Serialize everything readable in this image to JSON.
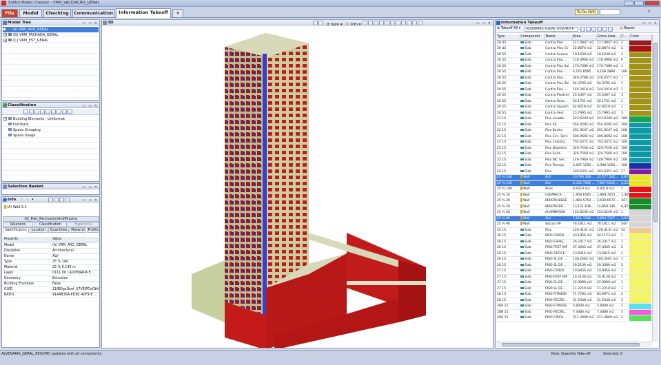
{
  "window": {
    "title": "Solibri Model Checker - VRM_VALIDAÇÃO_GERAL"
  },
  "tabs": [
    {
      "label": "File"
    },
    {
      "label": "Model"
    },
    {
      "label": "Checking"
    },
    {
      "label": "Communication"
    },
    {
      "label": "Information Takeoff"
    },
    {
      "label": "+"
    }
  ],
  "todo": {
    "label": "To-Do (3/6)"
  },
  "model_tree": {
    "title": "Model Tree",
    "items": [
      {
        "label": "(A) VRM_ARQ_GERAL"
      },
      {
        "label": "(B) VRM_FACHADA_GERAL"
      },
      {
        "label": "(C) VRM_EST_GERAL"
      }
    ]
  },
  "classification": {
    "title": "Classification",
    "items": [
      {
        "label": "Building Elements - Uniformat"
      },
      {
        "label": "Furniture"
      },
      {
        "label": "Space Grouping"
      },
      {
        "label": "Space Usage"
      }
    ]
  },
  "selection_basket": {
    "title": "Selection Basket"
  },
  "info": {
    "title": "Info",
    "element": "(A) Wall.5.1",
    "top_tabs": [
      "AC_Pset_RenovationAndPhasing"
    ],
    "tabs_row1": [
      "Relations",
      "Classification",
      "Hyperlinks"
    ],
    "tabs_row2": [
      "Identification",
      "Location",
      "Quantities",
      "Material",
      "Profile"
    ],
    "header": {
      "property": "Property",
      "value": "Value"
    },
    "rows": [
      {
        "p": "Model",
        "v": "(A) VRM_ARQ_GERAL"
      },
      {
        "p": "Discipline",
        "v": "Architectural"
      },
      {
        "p": "Name",
        "v": "ALV"
      },
      {
        "p": "Type",
        "v": "25 % 140"
      },
      {
        "p": "Material",
        "v": "25 % 0.140 m"
      },
      {
        "p": "Layer",
        "v": "0111 00 | ALVENARIA E..."
      },
      {
        "p": "Geometry",
        "v": "Extrusion"
      },
      {
        "p": "Building Envelope",
        "v": "False"
      },
      {
        "p": "GUID",
        "v": "11fBOgxOzof_U7VEIPDxObV"
      },
      {
        "p": "BATID",
        "v": "41A4B36A-EDBC-40F9-E..."
      }
    ]
  },
  "view3d": {
    "title": "3D",
    "spin": "Spin",
    "info": "Info"
  },
  "takeoff": {
    "title": "Information Takeoff",
    "takeoff_label": "Takeoff All",
    "selected_takeoff": "ALVENARIA_GERAL_RESUMO",
    "report": "Report",
    "columns": [
      "Type",
      "Component",
      "Name",
      "Area",
      "Gross Area",
      "C...",
      "Color"
    ],
    "rows": [
      {
        "type": "20 45",
        "comp": "Slab",
        "name": "Contra Piso",
        "area": "117.0847 m2",
        "gross": "117.0847 m2",
        "c": "2",
        "color": "#9a1c1c"
      },
      {
        "type": "20 45",
        "comp": "Slab",
        "name": "Contra Piso Cir",
        "area": "22.8874 m2",
        "gross": "22.8874 m2",
        "c": "2",
        "color": "#a8140e"
      },
      {
        "type": "20 55",
        "comp": "Slab",
        "name": "Contra Acesso",
        "area": "10.1639 m2",
        "gross": "10.1639 m2",
        "c": "1",
        "color": "#a39314"
      },
      {
        "type": "20 55",
        "comp": "Slab",
        "name": "Contra Piso ...",
        "area": "116.4966 m2",
        "gross": "116.4966 m2",
        "c": "6",
        "color": "#a39314"
      },
      {
        "type": "20 55",
        "comp": "Slab",
        "name": "Contra Piso Sal",
        "area": "170.7486 m2",
        "gross": "170.7486 m2",
        "c": "1",
        "color": "#a39314"
      },
      {
        "type": "20 55",
        "comp": "Slab",
        "name": "Contra Piso ...",
        "area": "4,152.8585 ...",
        "gross": "4,158.2894 ...",
        "c": "106",
        "color": "#a39314"
      },
      {
        "type": "20 55",
        "comp": "Slab",
        "name": "Contra Piso ...",
        "area": "340.2788 m2",
        "gross": "376.6577 m2",
        "c": "1",
        "color": "#a39314"
      },
      {
        "type": "20 55",
        "comp": "Slab",
        "name": "Contra Piso Zel",
        "area": "54.3795 m2",
        "gross": "54.3795 m2",
        "c": "1",
        "color": "#a39314"
      },
      {
        "type": "20 55",
        "comp": "Slab",
        "name": "Contra Piso ...",
        "area": "144.2419 m2",
        "gross": "144.2419 m2",
        "c": "1",
        "color": "#a39314"
      },
      {
        "type": "20 55",
        "comp": "Slab",
        "name": "Contra PisoHall",
        "area": "25.5407 m2",
        "gross": "25.5407 m2",
        "c": "3",
        "color": "#a39314"
      },
      {
        "type": "20 55",
        "comp": "Slab",
        "name": "Contra Rece...",
        "area": "20.1751 m2",
        "gross": "20.1751 m2",
        "c": "1",
        "color": "#a39314"
      },
      {
        "type": "20 55",
        "comp": "Slab",
        "name": "Contra Squash",
        "area": "62.8219 m2",
        "gross": "62.8219 m2",
        "c": "1",
        "color": "#a39314"
      },
      {
        "type": "20 55",
        "comp": "Slab",
        "name": "Contra Vest.",
        "area": "15.7995 m2",
        "gross": "15.7995 m2",
        "c": "3",
        "color": "#a39314"
      },
      {
        "type": "21 15",
        "comp": "Slab",
        "name": "Piso Lavabo",
        "area": "223.6249 m2",
        "gross": "223.6249 m2",
        "c": "108",
        "color": "#17a44a"
      },
      {
        "type": "22 15",
        "comp": "Slab",
        "name": "Piso AS",
        "area": "554.0292 m2",
        "gross": "554.0292 m2",
        "c": "108",
        "color": "#0c9aa6"
      },
      {
        "type": "22 15",
        "comp": "Slab",
        "name": "Piso Banho",
        "area": "291.9247 m2",
        "gross": "291.9247 m2",
        "c": "108",
        "color": "#0c9aa6"
      },
      {
        "type": "22 15",
        "comp": "Slab",
        "name": "Piso Circ. Serv",
        "area": "406.0692 m2",
        "gross": "406.0692 m2",
        "c": "108",
        "color": "#0c9aa6"
      },
      {
        "type": "22 15",
        "comp": "Slab",
        "name": "Piso Cozinha",
        "area": "702.6372 m2",
        "gross": "702.6372 m2",
        "c": "108",
        "color": "#0c9aa6"
      },
      {
        "type": "22 15",
        "comp": "Slab",
        "name": "Piso Depósito",
        "area": "329.7240 m2",
        "gross": "329.7240 m2",
        "c": "108",
        "color": "#0c9aa6"
      },
      {
        "type": "22 15",
        "comp": "Slab",
        "name": "Piso Suite",
        "area": "324.7560 m2",
        "gross": "324.7560 m2",
        "c": "108",
        "color": "#0c9aa6"
      },
      {
        "type": "22 15",
        "comp": "Slab",
        "name": "Piso WC Ser...",
        "area": "149.7960 m2",
        "gross": "149.7960 m2",
        "c": "108",
        "color": "#0c9aa6"
      },
      {
        "type": "23 15",
        "comp": "Slab",
        "name": "Piso Terraço",
        "area": "4,097.1250 ...",
        "gross": "4,098.1250 ...",
        "c": "108",
        "color": "#1b2fa8"
      },
      {
        "type": "24 15",
        "comp": "Slab",
        "name": "Piso",
        "area": "183.6351 m2",
        "gross": "183.6351 m2",
        "c": "27",
        "color": "#8a1aa0"
      },
      {
        "type": "25 % 140",
        "comp": "Wall",
        "name": "ALV",
        "area": "10,780.368...",
        "gross": "12,577.542...",
        "c": "3,874",
        "color": "#e8e81e",
        "sel": true
      },
      {
        "type": "25 % 190",
        "comp": "Wall",
        "name": "ALV",
        "area": "6,335.7505 ...",
        "gross": "7,807.5526 ...",
        "c": "2,222",
        "color": "#e8e81e",
        "sel": true
      },
      {
        "type": "25 % 190",
        "comp": "Wall",
        "name": "ALVx",
        "area": "6.9219 m2",
        "gross": "6.9219 m2",
        "c": "1",
        "color": "#e81414"
      },
      {
        "type": "25 % 20",
        "comp": "Wall",
        "name": "CERÂMICA ...",
        "area": "1,959.6565 ...",
        "gross": "1,969.7015 ...",
        "c": "1,365",
        "color": "#e81414"
      },
      {
        "type": "25 % 20",
        "comp": "Wall",
        "name": "IBRATIN BEGE",
        "area": "1,460.5754 ...",
        "gross": "2,030.6572 ...",
        "c": "447",
        "color": "#1a8a2a"
      },
      {
        "type": "25 % 20",
        "comp": "Wall",
        "name": "IBRATIN BR...",
        "area": "13,121.636...",
        "gross": "14,869.336...",
        "c": "6,477",
        "color": "#1a8a2a"
      },
      {
        "type": "25 % 50",
        "comp": "Wall",
        "name": "ALAMBRADO",
        "area": "154.6249 m2",
        "gross": "154.6249 m2",
        "c": "1",
        "color": "#d6d6d6"
      },
      {
        "type": "25 % 90",
        "comp": "Wall",
        "name": "ALV",
        "area": "7,821.7288 ...",
        "gross": "9,804.7327 ...",
        "c": "2,972",
        "color": "#d6d6d6",
        "sel": true
      },
      {
        "type": "25 % 90",
        "comp": "Wall",
        "name": "Sóculo 09",
        "area": "78.1811 m2",
        "gross": "78.1811 m2",
        "c": "540",
        "color": "#d6d6d6"
      },
      {
        "type": "25 15",
        "comp": "Slab",
        "name": "Piso",
        "area": "126.4131 m2",
        "gross": "126.4131 m2",
        "c": "54",
        "color": "#f0c890"
      },
      {
        "type": "26 15",
        "comp": "Slab",
        "name": "PISO CYBER",
        "area": "43.1956 m2",
        "gross": "54.1173 m2",
        "c": "1",
        "color": "#f5f560"
      },
      {
        "type": "26 15",
        "comp": "Slab",
        "name": "PISO ESPAÇ...",
        "area": "26.2417 m2",
        "gross": "26.2417 m2",
        "c": "1",
        "color": "#f5f560"
      },
      {
        "type": "26 15",
        "comp": "Slab",
        "name": "PISO FEST INF",
        "area": "37.4345 m2",
        "gross": "37.4345 m2",
        "c": "2",
        "color": "#f5f560"
      },
      {
        "type": "26 15",
        "comp": "Slab",
        "name": "PISO OFFICE",
        "area": "13.6915 m2",
        "gross": "13.6915 m2",
        "c": "2",
        "color": "#f5f560"
      },
      {
        "type": "26 15",
        "comp": "Slab",
        "name": "PISO SL DE ...",
        "area": "138.2562 m2",
        "gross": "160.3561 m2",
        "c": "1",
        "color": "#f5f560"
      },
      {
        "type": "26 15",
        "comp": "Slab",
        "name": "PISO SL DE ...",
        "area": "29.2139 m2",
        "gross": "29.3009 m2",
        "c": "2",
        "color": "#f5f560"
      },
      {
        "type": "27 15",
        "comp": "Slab",
        "name": "PISO CYBER",
        "area": "10.8456 m2",
        "gross": "10.8456 m2",
        "c": "1",
        "color": "#f5f560"
      },
      {
        "type": "27 15",
        "comp": "Slab",
        "name": "PISO FEST INF",
        "area": "16.2146 m2",
        "gross": "16.9158 m2",
        "c": "1",
        "color": "#f5f560"
      },
      {
        "type": "27 15",
        "comp": "Slab",
        "name": "PISO SL DE ...",
        "area": "22.0999 m2",
        "gross": "22.0999 m2",
        "c": "1",
        "color": "#f5f560"
      },
      {
        "type": "27 15",
        "comp": "Slab",
        "name": "PISO SL DE ...",
        "area": "11.2210 m2",
        "gross": "11.2210 m2",
        "c": "1",
        "color": "#f5f560"
      },
      {
        "type": "28 15",
        "comp": "Slab",
        "name": "PISO FITNESS",
        "area": "71.7785 m2",
        "gross": "83.9972 m2",
        "c": "2",
        "color": "#f5f560"
      },
      {
        "type": "28 15",
        "comp": "Slab",
        "name": "PISO RECRE...",
        "area": "31.5348 m2",
        "gross": "31.5348 m2",
        "c": "2",
        "color": "#f5f560"
      },
      {
        "type": "28A 15",
        "comp": "Slab",
        "name": "PISO FITNESS",
        "area": "5.9000 m2",
        "gross": "5.9000 m2",
        "c": "2",
        "color": "#5ae0f5"
      },
      {
        "type": "28B 15",
        "comp": "Slab",
        "name": "PISO RECRE...",
        "area": "7.4486 m2",
        "gross": "7.4486 m2",
        "c": "5",
        "color": "#f55ae0"
      },
      {
        "type": "29A 15",
        "comp": "Slab",
        "name": "PISO CIRCU...",
        "area": "211.3009 m2",
        "gross": "211.3009 m2",
        "c": "2",
        "color": "#5ae05a"
      }
    ]
  },
  "status": {
    "left": "ALVENARIA_GERAL_RESUMO updated with all components",
    "role": "Role: Quantity Take-off",
    "selected": "Selected: 0"
  }
}
